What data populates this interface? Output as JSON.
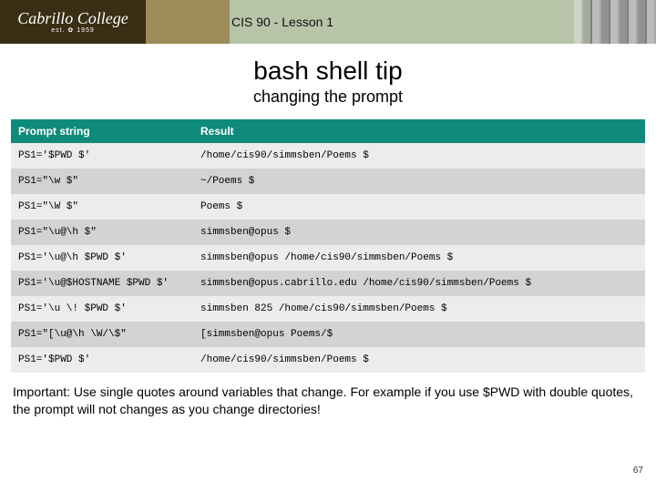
{
  "logo": {
    "name": "Cabrillo College",
    "est": "est. ✿ 1959"
  },
  "header": {
    "course": "CIS 90 - Lesson 1"
  },
  "title": "bash shell tip",
  "subtitle": "changing the prompt",
  "table": {
    "headers": {
      "prompt": "Prompt string",
      "result": "Result"
    },
    "rows": [
      {
        "prompt": "PS1='$PWD $'",
        "result": "/home/cis90/simmsben/Poems $"
      },
      {
        "prompt": "PS1=\"\\w $\"",
        "result": "~/Poems $"
      },
      {
        "prompt": "PS1=\"\\W $\"",
        "result": "Poems $"
      },
      {
        "prompt": "PS1=\"\\u@\\h $\"",
        "result": "simmsben@opus $"
      },
      {
        "prompt": "PS1='\\u@\\h $PWD $'",
        "result": "simmsben@opus /home/cis90/simmsben/Poems $"
      },
      {
        "prompt": "PS1='\\u@$HOSTNAME $PWD $'",
        "result": "simmsben@opus.cabrillo.edu /home/cis90/simmsben/Poems $"
      },
      {
        "prompt": "PS1='\\u \\! $PWD $'",
        "result": "simmsben 825 /home/cis90/simmsben/Poems $"
      },
      {
        "prompt": "PS1=\"[\\u@\\h \\W/\\$\"",
        "result": "[simmsben@opus Poems/$"
      },
      {
        "prompt": "PS1='$PWD $'",
        "result": "/home/cis90/simmsben/Poems $"
      }
    ]
  },
  "footnote": "Important:  Use  single quotes around variables that change.  For example if you use $PWD with double quotes, the prompt will not changes as you change directories!",
  "page_number": "67"
}
